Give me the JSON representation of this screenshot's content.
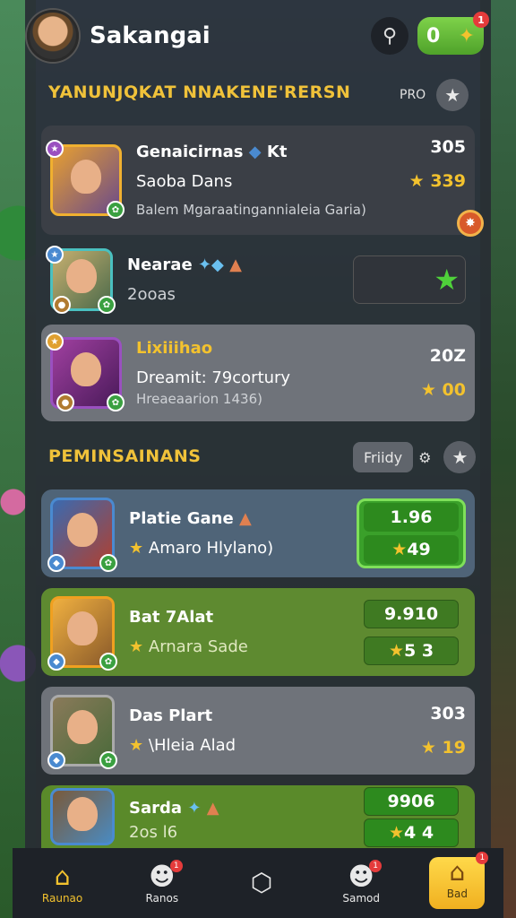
{
  "header": {
    "title": "Sakangai",
    "coin_value": "0",
    "coin_badge": "1"
  },
  "section1": {
    "title": "YANUNJQKAT NNAKENE'RERSN",
    "pro_label": "PRO"
  },
  "cards1": [
    {
      "name": "Genaicirnas",
      "name_suffix": "Kt",
      "sub": "Saoba Dans",
      "desc": "Balem Mgaraatingannialeia Garia)",
      "value": "305",
      "stars": "339"
    },
    {
      "name": "Nearae",
      "sub": "2ooas",
      "value": ""
    },
    {
      "name": "Lixiiihao",
      "sub": "Dreamit: 79cortury",
      "desc": "Hreaeaarion 1436)",
      "value": "20Z",
      "stars": "00"
    }
  ],
  "section2": {
    "title": "PEMINSAINANS",
    "filter_label": "Friidy"
  },
  "cards2": [
    {
      "name": "Platie Gane",
      "sub": "Amaro Hlylano)",
      "value": "1.96",
      "stars": "49"
    },
    {
      "name": "Bat 7Alat",
      "sub": "Arnara Sade",
      "value": "9.910",
      "stars": "5 3"
    },
    {
      "name": "Das Plart",
      "sub": "\\Hleia Alad",
      "value": "303",
      "stars": "19"
    },
    {
      "name": "Sarda",
      "sub": "2os l6",
      "value": "9906",
      "stars": "4 4"
    }
  ],
  "nav": [
    {
      "label": "Raunao",
      "icon": "home-icon"
    },
    {
      "label": "Ranos",
      "icon": "user-icon",
      "badge": "1"
    },
    {
      "label": "",
      "icon": "shield-icon"
    },
    {
      "label": "Samod",
      "icon": "user-icon",
      "badge": "1"
    },
    {
      "label": "Bad",
      "icon": "house-icon",
      "badge": "1"
    }
  ],
  "colors": {
    "accent": "#f3c22e",
    "green": "#3aa02a",
    "panel": "#3b3f46"
  }
}
